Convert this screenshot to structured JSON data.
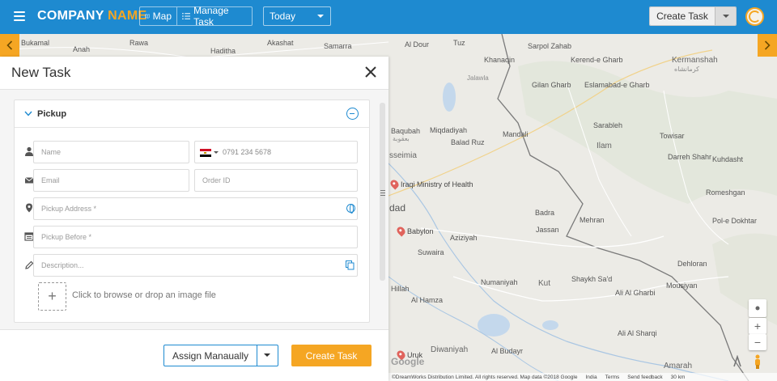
{
  "header": {
    "brand_part1": "COMPANY",
    "brand_part2": "NAME",
    "view_map": "Map",
    "view_manage_task": "Manage Task",
    "date_filter": "Today",
    "create_task": "Create Task"
  },
  "colors": {
    "primary": "#1e8ad0",
    "accent": "#f5a623"
  },
  "map": {
    "labels": [
      {
        "text": "Baqubah",
        "cls": "dark"
      },
      {
        "text": "بعقوبة",
        "cls": ""
      },
      {
        "text": "Miqdadiyah",
        "cls": "dark"
      },
      {
        "text": "Mandali",
        "cls": "dark"
      },
      {
        "text": "Balad Ruz",
        "cls": "dark"
      },
      {
        "text": "Khanaqin",
        "cls": "dark"
      },
      {
        "text": "Jalawla",
        "cls": ""
      },
      {
        "text": "Sarpol Zahab",
        "cls": "dark"
      },
      {
        "text": "Kerend-e Gharb",
        "cls": "dark"
      },
      {
        "text": "Gilan Gharb",
        "cls": "dark"
      },
      {
        "text": "Kermanshah",
        "cls": "big"
      },
      {
        "text": "کرمانشاه",
        "cls": ""
      },
      {
        "text": "Eslamabad-e Gharb",
        "cls": "dark"
      },
      {
        "text": "Ilam",
        "cls": "big"
      },
      {
        "text": "Sarableh",
        "cls": "dark"
      },
      {
        "text": "Towisar",
        "cls": "dark"
      },
      {
        "text": "Darreh Shahr",
        "cls": "dark"
      },
      {
        "text": "Kuhdasht",
        "cls": "dark"
      },
      {
        "text": "Romeshgan",
        "cls": "dark"
      },
      {
        "text": "Pol-e Dokhtar",
        "cls": "dark"
      },
      {
        "text": "Dehloran",
        "cls": "dark"
      },
      {
        "text": "Mousiyan",
        "cls": "dark"
      },
      {
        "text": "Mehran",
        "cls": "dark"
      },
      {
        "text": "Badra",
        "cls": "dark"
      },
      {
        "text": "Jassan",
        "cls": "dark"
      },
      {
        "text": "Aziziyah",
        "cls": "dark"
      },
      {
        "text": "Suwaira",
        "cls": "dark"
      },
      {
        "text": "Numaniyah",
        "cls": "dark"
      },
      {
        "text": "Kut",
        "cls": "big"
      },
      {
        "text": "Shaykh Sa'd",
        "cls": "dark"
      },
      {
        "text": "Ali Al Gharbi",
        "cls": "dark"
      },
      {
        "text": "Al Hamza",
        "cls": "dark"
      },
      {
        "text": "Diwaniyah",
        "cls": "big"
      },
      {
        "text": "Al Budayr",
        "cls": "dark"
      },
      {
        "text": "Ali Al Sharqi",
        "cls": "dark"
      },
      {
        "text": "Amarah",
        "cls": "big"
      },
      {
        "text": "Hillah",
        "cls": "dark"
      },
      {
        "text": "Bukamal",
        "cls": "dark"
      },
      {
        "text": "Rawa",
        "cls": "dark"
      },
      {
        "text": "Haditha",
        "cls": "dark"
      },
      {
        "text": "Anah",
        "cls": "dark"
      },
      {
        "text": "Samarra",
        "cls": "dark"
      },
      {
        "text": "Al Dour",
        "cls": "dark"
      },
      {
        "text": "Tuz",
        "cls": "dark"
      },
      {
        "text": "Akashat",
        "cls": "dark"
      }
    ],
    "pois": [
      {
        "text": "Iraqi Ministry of Health"
      },
      {
        "text": "Babylon"
      },
      {
        "text": "Uruk"
      }
    ],
    "city_partial_1": "sseimia",
    "city_partial_2": "dad",
    "google_logo": "Google",
    "attribution": "©DreamWorks Distribution Limited. All rights reserved. Map data ©2018 Google",
    "attr_india": "India",
    "attr_terms": "Terms",
    "attr_feedback": "Send feedback",
    "attr_scale": "30 km"
  },
  "panel": {
    "title": "New Task",
    "section_title": "Pickup",
    "name_placeholder": "Name",
    "phone_placeholder": "0791 234 5678",
    "email_placeholder": "Email",
    "order_id_placeholder": "Order ID",
    "pickup_address_placeholder": "Pickup Address *",
    "pickup_before_placeholder": "Pickup Before *",
    "description_placeholder": "Description...",
    "upload_text": "Click to browse or drop an image file",
    "upload_plus": "+",
    "assign_label": "Assign Manaually",
    "create_task_label": "Create Task"
  }
}
